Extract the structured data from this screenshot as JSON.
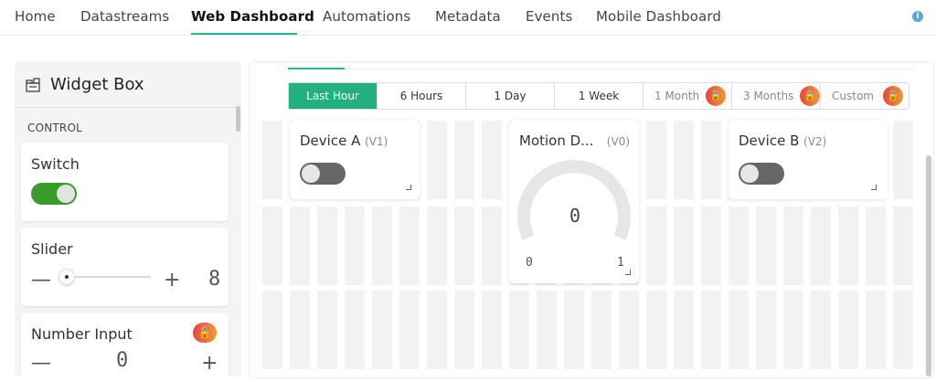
{
  "nav": {
    "tabs": [
      "Home",
      "Datastreams",
      "Web Dashboard",
      "Automations",
      "Metadata",
      "Events",
      "Mobile Dashboard"
    ],
    "active_tab": "Web Dashboard",
    "info_icon": "i"
  },
  "widget_box": {
    "title": "Widget Box",
    "section": "CONTROL",
    "widgets": {
      "switch": {
        "label": "Switch",
        "state": "on"
      },
      "slider": {
        "label": "Slider",
        "value": "8",
        "minus": "—",
        "plus": "+"
      },
      "number_input": {
        "label": "Number Input",
        "value": "0",
        "minus": "—",
        "plus": "+",
        "locked": true
      }
    }
  },
  "time_range": {
    "options": [
      "Last Hour",
      "6 Hours",
      "1 Day",
      "1 Week",
      "1 Month",
      "3 Months",
      "Custom"
    ],
    "active": "Last Hour",
    "locked": [
      "1 Month",
      "3 Months",
      "Custom"
    ]
  },
  "dashboard_widgets": {
    "device_a": {
      "title": "Device A",
      "pin": "(V1)",
      "state": "off"
    },
    "motion": {
      "title": "Motion D...",
      "pin": "(V0)",
      "value": "0",
      "min": "0",
      "max": "1"
    },
    "device_b": {
      "title": "Device B",
      "pin": "(V2)",
      "state": "off"
    }
  },
  "colors": {
    "accent": "#23b89a",
    "active_range": "#23b07f",
    "toggle_on": "#3a9b2c",
    "toggle_off": "#666666",
    "lock_gradient_start": "#e8453c",
    "lock_gradient_end": "#f09a3c"
  }
}
